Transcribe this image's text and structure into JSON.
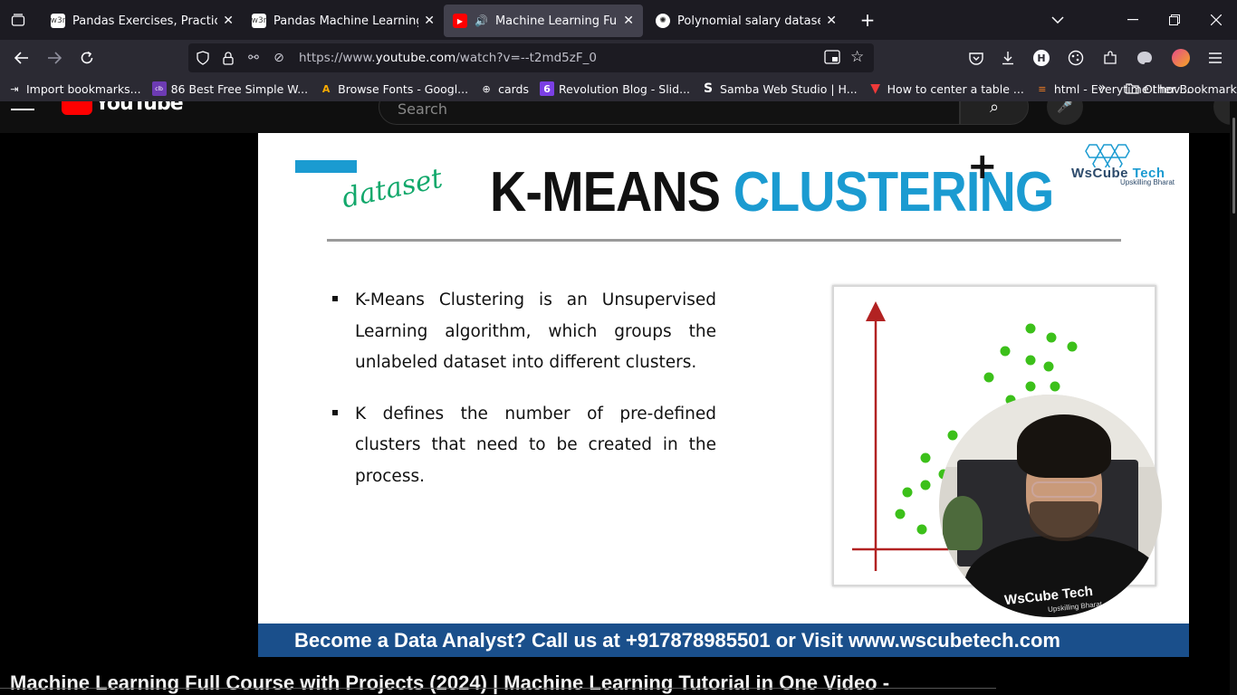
{
  "browser": {
    "tabs": [
      {
        "title": "Pandas Exercises, Practice, Solut",
        "favicon": "w3r",
        "active": false
      },
      {
        "title": "Pandas Machine Learning Integ",
        "favicon": "w3r",
        "active": false
      },
      {
        "title": "Machine Learning Full Cour",
        "favicon": "youtube",
        "active": true,
        "playing_audio": true
      },
      {
        "title": "Polynomial salary dataset",
        "favicon": "openai",
        "active": false
      }
    ],
    "new_tab_label": "+",
    "url": {
      "prefix": "https://www.",
      "domain": "youtube.com",
      "path": "/watch?v=--t2md5zF_0"
    },
    "bookmarks": [
      {
        "label": "Import bookmarks...",
        "icon": "import-icon"
      },
      {
        "label": "86 Best Free Simple W...",
        "icon": "colorlib-icon"
      },
      {
        "label": "Browse Fonts - Googl...",
        "icon": "google-fonts-icon"
      },
      {
        "label": "cards",
        "icon": "globe-icon"
      },
      {
        "label": "Revolution Blog - Slid...",
        "icon": "revolution-icon"
      },
      {
        "label": "Samba Web Studio | H...",
        "icon": "samba-icon"
      },
      {
        "label": "How to center a table ...",
        "icon": "vivaldi-icon"
      },
      {
        "label": "html - Everytime I hov...",
        "icon": "stackoverflow-icon"
      }
    ],
    "other_bookmarks": "Other Bookmarks"
  },
  "youtube": {
    "search_placeholder": "Search",
    "logo_text": "YouTube"
  },
  "slide": {
    "handwriting": "dataset",
    "title_part1": "K-MEANS ",
    "title_part2": "CLUSTERING",
    "plus": "+",
    "brand_name_1": "WsCube",
    "brand_name_2": " Tech",
    "brand_tag": "Upskilling Bharat",
    "bullets": [
      "K-Means Clustering is an Unsupervised Learning algorithm, which groups the unlabeled dataset into different clusters.",
      "K defines the number of pre-defined clusters that need to be created in the process."
    ],
    "webcam_logo": "WsCube Tech",
    "webcam_logo_sub": "Upskilling Bharat",
    "banner": "Become a Data Analyst? Call us at +917878985501 or Visit www.wscubetech.com",
    "colors": {
      "accent": "#1b9bd1",
      "banner": "#1a4f8b",
      "axis": "#b22222",
      "points": "#3cc01a"
    }
  },
  "video_title": "Machine Learning Full Course with Projects (2024) | Machine Learning Tutorial in One Video -"
}
